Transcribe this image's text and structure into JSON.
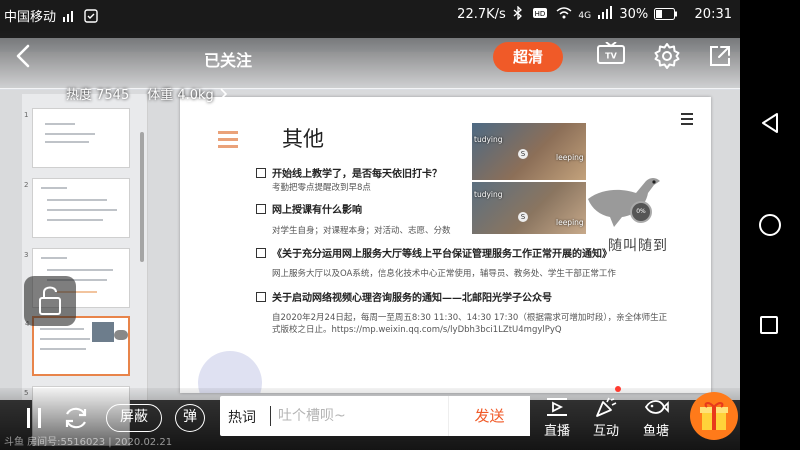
{
  "status_bar": {
    "carrier": "中国移动",
    "net_speed": "22.7K/s",
    "network": "4G",
    "battery": "30%",
    "time": "20:31"
  },
  "top_bar": {
    "follow_label": "已关注",
    "quality_label": "超清",
    "heat": "热度 7545",
    "weight": "体重 4.0kg"
  },
  "slide": {
    "title": "其他",
    "bullets": [
      {
        "title": "开始线上教学了，是否每天依旧打卡？",
        "sub": "考勤把零点提醒改到早8点"
      },
      {
        "title": "网上授课有什么影响",
        "sub": "对学生自身；对课程本身；对活动、志愿、分数"
      },
      {
        "title": "《关于充分运用网上服务大厅等线上平台保证管理服务工作正常开展的通知》",
        "sub": "网上服务大厅以及OA系统，信息化技术中心正常使用，辅导员、教务处、学生干部正常工作"
      },
      {
        "title": "关于启动网络视频心理咨询服务的通知——北邮阳光学子公众号",
        "sub": "自2020年2月24日起，每周一至周五8:30 11:30、14:30 17:30（根据需求可增加时段），亲全体师生正",
        "sub2": "式版校之日止。https://mp.weixin.qq.com/s/lyDbh3bci1LZtU4mgylPyQ"
      }
    ],
    "meme_top_left": "tudying",
    "meme_top_right": "leeping",
    "meme_bot_left": "tudying",
    "meme_bot_right": "leeping",
    "meme_s": "S",
    "logo_text": "随叫随到",
    "badge": "0%"
  },
  "thumbnails": [
    "1",
    "2",
    "3",
    "4",
    "5"
  ],
  "bottom_bar": {
    "block_label": "屏蔽",
    "danmu_label": "弹",
    "hot_word": "热词",
    "comment_placeholder": "吐个槽呗~",
    "send_label": "发送",
    "live_label": "直播",
    "interact_label": "互动",
    "pond_label": "鱼塘"
  },
  "room_watermark": "斗鱼 房间号:5516023 | 2020.02.21",
  "colors": {
    "accent": "#f05a28",
    "gift": "#ff7a1a"
  }
}
